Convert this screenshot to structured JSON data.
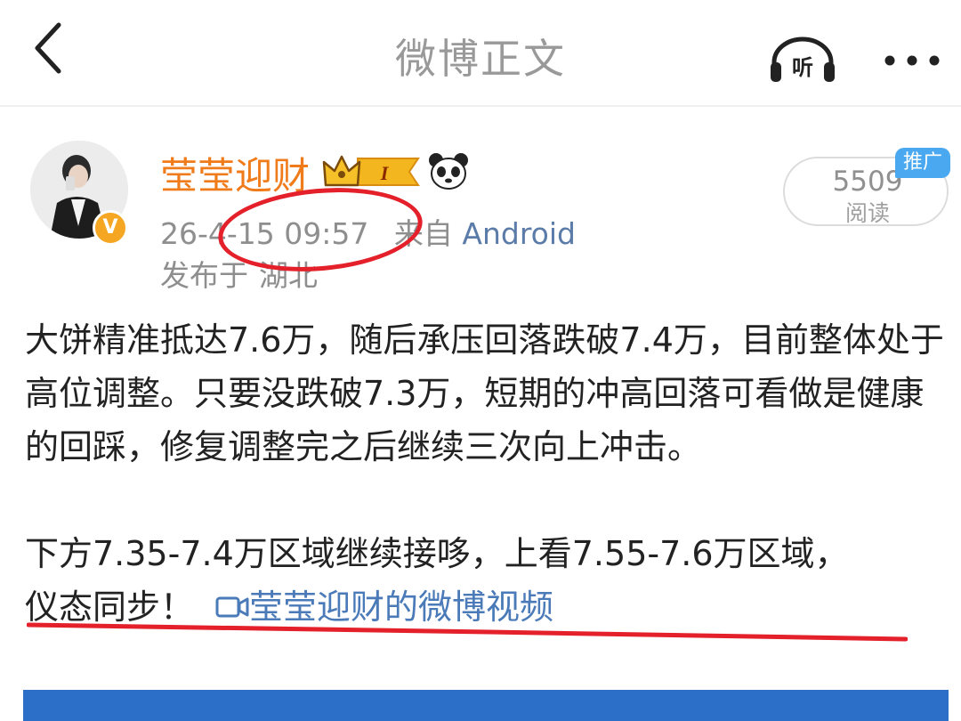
{
  "header": {
    "title": "微博正文",
    "listen_label": "听"
  },
  "post": {
    "author": {
      "name": "莹莹迎财",
      "level_badge": "I",
      "verified_mark": "V"
    },
    "timestamp": "26-4-15 09:57",
    "source_prefix": "来自",
    "source": "Android",
    "location_prefix": "发布于",
    "location": "湖北",
    "read_count": "5509",
    "read_label": "阅读",
    "promo_tag": "推广",
    "content": {
      "paragraph_1": "大饼精准抵达7.6万，随后承压回落跌破7.4万，目前整体处于高位调整。只要没跌破7.3万，短期的冲高回落可看做是健康的回踩，修复调整完之后继续三次向上冲击。",
      "paragraph_2_line1": "下方7.35-7.4万区域继续接哆，上看7.55-7.6万区域，",
      "paragraph_2_line2": "仪态同步！",
      "video_link": "莹莹迎财的微博视频"
    }
  },
  "colors": {
    "username": "#f07b1b",
    "link": "#4a7ab8",
    "annotation_red": "#e4202a",
    "promo_bg": "#4aa8f0"
  },
  "icons": [
    "back-arrow-icon",
    "listen-headphone-icon",
    "more-dots-icon",
    "crown-badge-icon",
    "panda-icon",
    "video-camera-icon"
  ]
}
